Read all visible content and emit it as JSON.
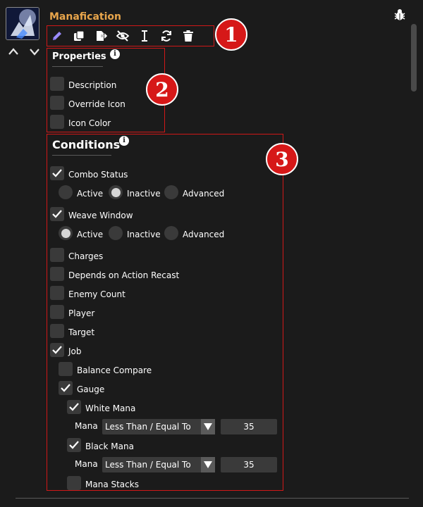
{
  "action": {
    "title": "Manafication"
  },
  "toolbar": {
    "icons": [
      "pencil-icon",
      "copy-icon",
      "export-icon",
      "hide-icon",
      "text-cursor-icon",
      "refresh-icon",
      "trash-icon"
    ]
  },
  "badges": [
    "1",
    "2",
    "3"
  ],
  "properties": {
    "title": "Properties",
    "items": [
      "Description",
      "Override Icon",
      "Icon Color"
    ]
  },
  "conditions": {
    "title": "Conditions",
    "combo_status": {
      "label": "Combo Status",
      "options": [
        "Active",
        "Inactive",
        "Advanced"
      ]
    },
    "weave_window": {
      "label": "Weave Window",
      "options": [
        "Active",
        "Inactive",
        "Advanced"
      ]
    },
    "charges": "Charges",
    "depends_on_action_recast": "Depends on Action Recast",
    "enemy_count": "Enemy Count",
    "player": "Player",
    "target": "Target",
    "job": "Job",
    "balance_compare": "Balance Compare",
    "gauge": "Gauge",
    "white_mana": {
      "label": "White Mana",
      "field_label": "Mana",
      "operator": "Less Than / Equal To",
      "value": "35"
    },
    "black_mana": {
      "label": "Black Mana",
      "field_label": "Mana",
      "operator": "Less Than / Equal To",
      "value": "35"
    },
    "mana_stacks": "Mana Stacks"
  },
  "colors": {
    "accent": "#e8a54b",
    "highlight": "#d01818",
    "checkbox_bg": "#3a3a3a",
    "panel_bg": "#1b1b1b"
  }
}
